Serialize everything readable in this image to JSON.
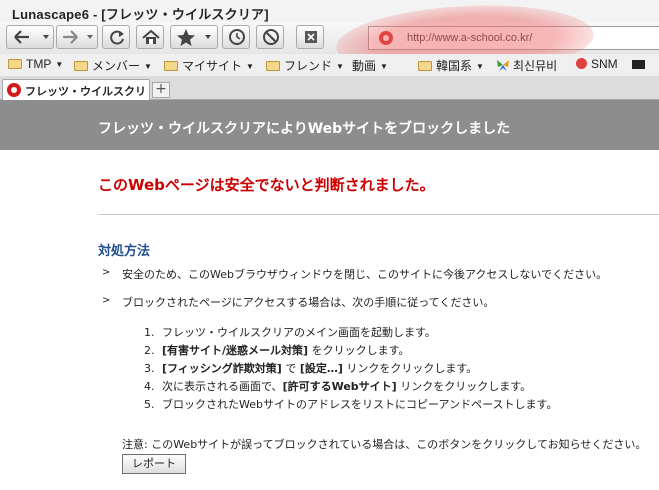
{
  "window": {
    "title": "Lunascape6 - [フレッツ・ウイルスクリア]"
  },
  "address_bar": {
    "url": "http://www.a-school.co.kr/"
  },
  "bookmarks": [
    {
      "label": "TMP",
      "type": "folder"
    },
    {
      "label": "メンバー",
      "type": "folder"
    },
    {
      "label": "マイサイト",
      "type": "folder"
    },
    {
      "label": "フレンド",
      "type": "folder"
    },
    {
      "label": "動画",
      "type": "folder"
    },
    {
      "label": "韓国系",
      "type": "folder"
    },
    {
      "label": "최신뮤비",
      "type": "link"
    },
    {
      "label": "SNM",
      "type": "link"
    }
  ],
  "tab": {
    "label": "フレッツ・ウイルスクリア"
  },
  "page": {
    "banner": "フレッツ・ウイルスクリアによりWebサイトをブロックしました",
    "warning": "このWebページは安全でないと判断されました。",
    "section_title": "対処方法",
    "bullets": [
      "安全のため、このWebブラウザウィンドウを閉じ、このサイトに今後アクセスしないでください。",
      "ブロックされたページにアクセスする場合は、次の手順に従ってください。"
    ],
    "steps": [
      {
        "num": "1.",
        "bold": "",
        "text": "フレッツ・ウイルスクリアのメイン画面を起動します。"
      },
      {
        "num": "2.",
        "bold": "[有害サイト/迷惑メール対策]",
        "text": " をクリックします。"
      },
      {
        "num": "3.",
        "bold": "[フィッシング詐欺対策]",
        "text": " で ",
        "bold2": "[設定…]",
        "text2": " リンクをクリックします。"
      },
      {
        "num": "4.",
        "bold": "",
        "text": "次に表示される画面で、",
        "bold2": "[許可するWebサイト]",
        "text2": " リンクをクリックします。"
      },
      {
        "num": "5.",
        "bold": "",
        "text": "ブロックされたWebサイトのアドレスをリストにコピーアンドペーストします。"
      }
    ],
    "note": "注意: このWebサイトが誤ってブロックされている場合は、このボタンをクリックしてお知らせください。",
    "report_button": "レポート"
  },
  "colors": {
    "banner_bg": "#8d8d8d",
    "warning": "#cc0000",
    "section": "#1f4e8f"
  }
}
